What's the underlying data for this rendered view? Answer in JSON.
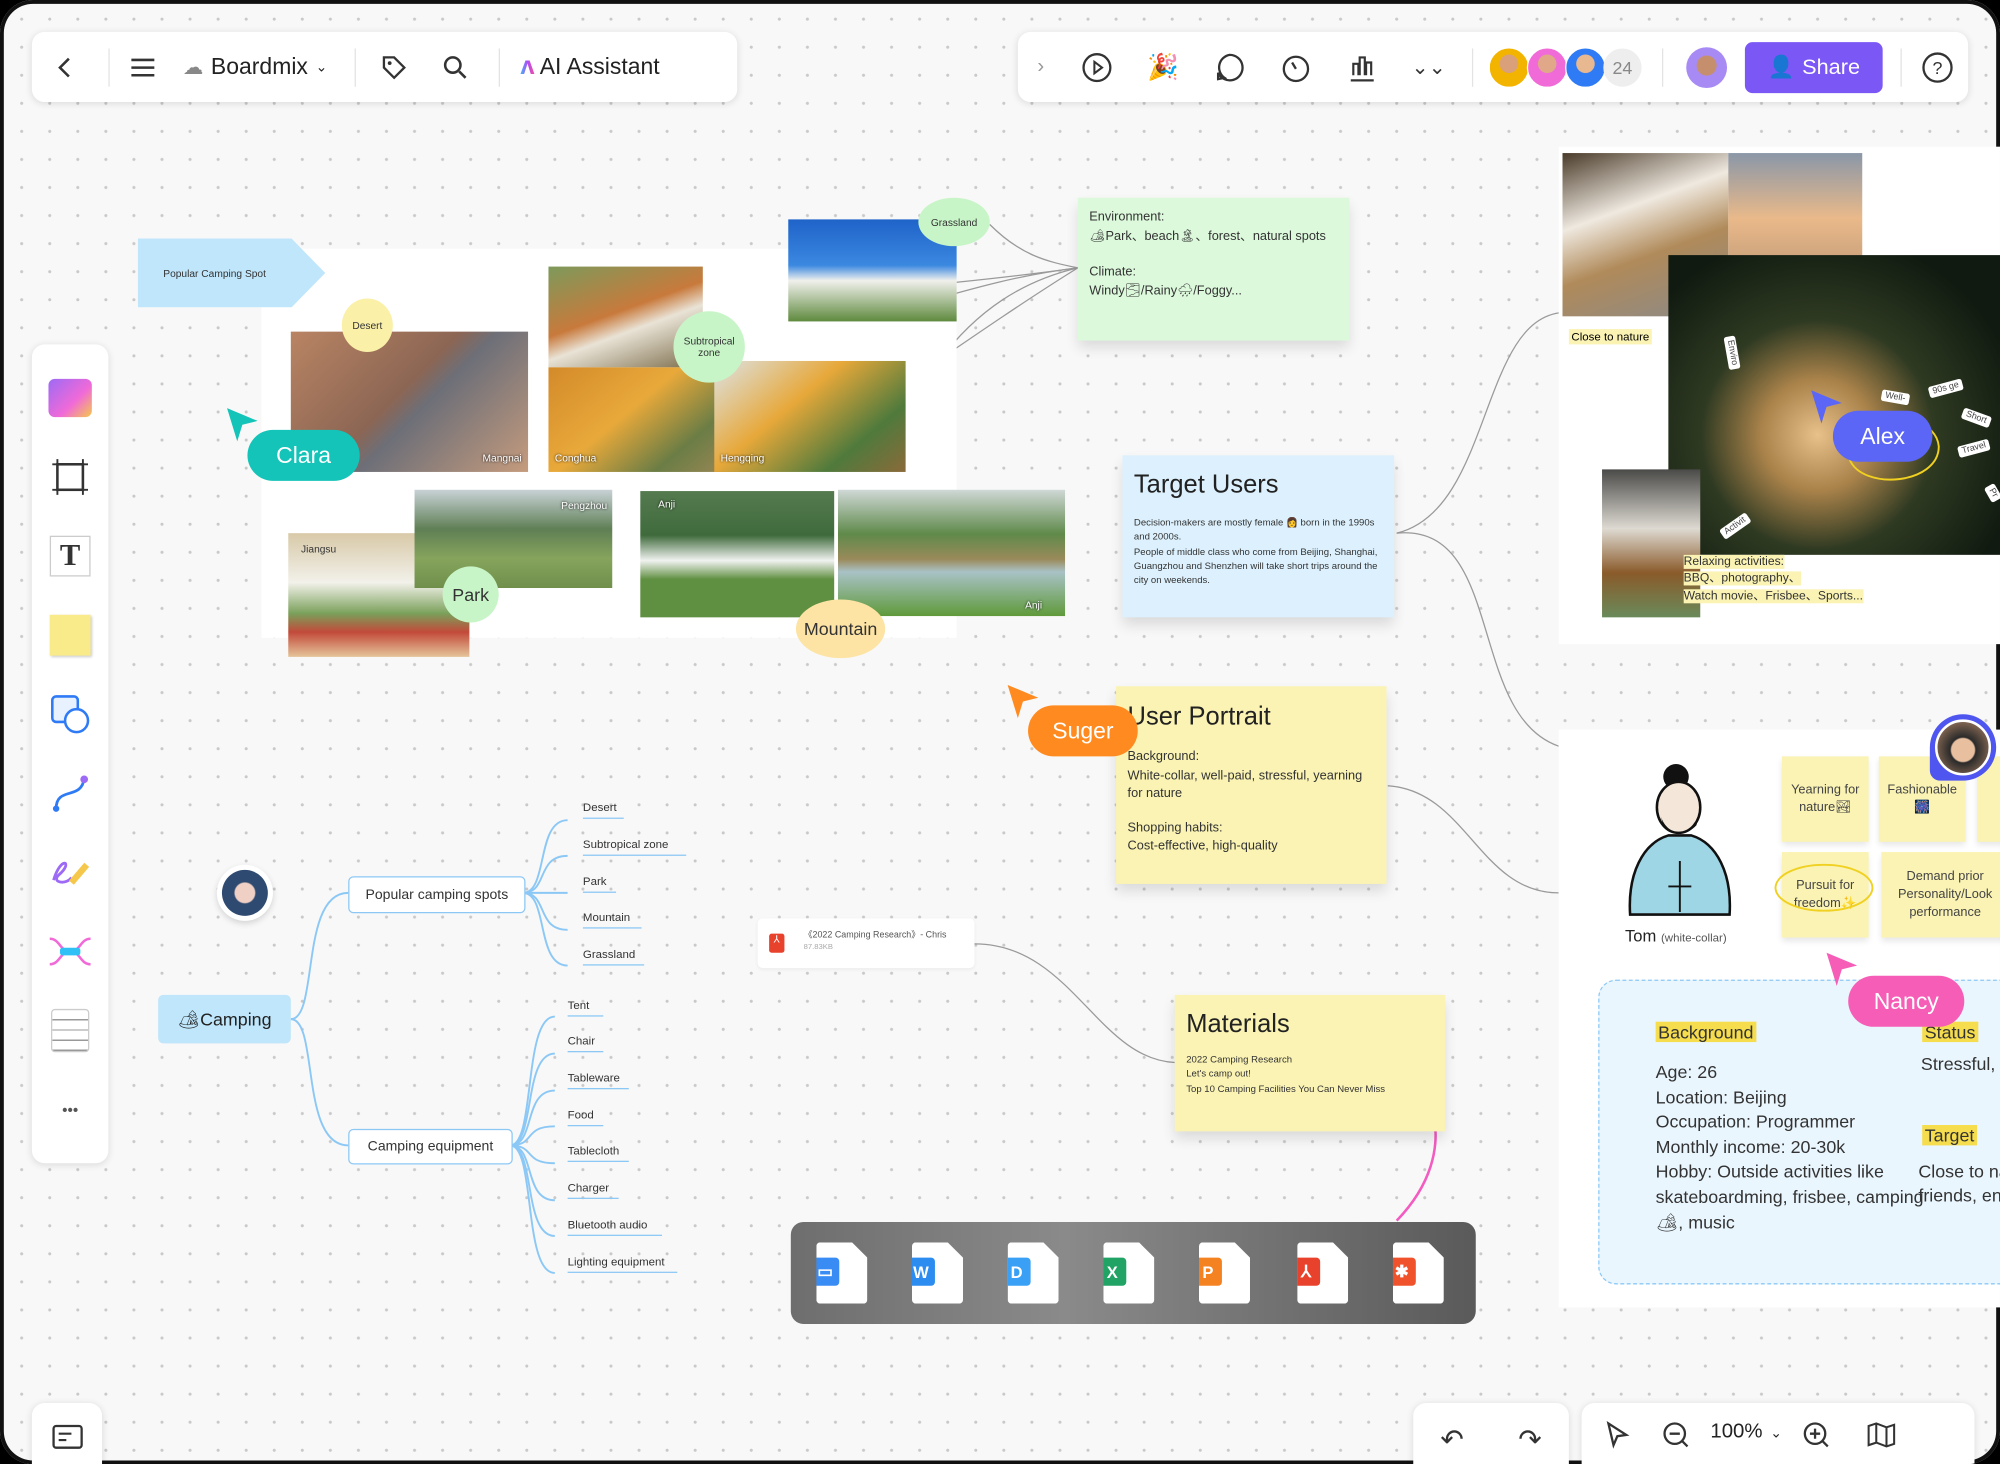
{
  "top_left_bar": {
    "app_name": "Boardmix",
    "ai_label": "AI Assistant",
    "icons": [
      "back-chevron",
      "menu",
      "cloud",
      "tag",
      "search"
    ]
  },
  "top_right_bar": {
    "collaborator_count": "24",
    "share_label": "Share",
    "icons": [
      "expand-chevron",
      "play",
      "celebrate",
      "comment",
      "timer",
      "chart",
      "more",
      "help"
    ]
  },
  "left_toolbar": {
    "tools": [
      "templates",
      "frame",
      "text",
      "sticky-note",
      "shape",
      "connector",
      "pen",
      "mindmap",
      "list",
      "more"
    ],
    "text_glyph": "T",
    "more_glyph": "•••"
  },
  "bottom_bar": {
    "zoom": "100%"
  },
  "board": {
    "spot_banner": "Popular Camping Spot",
    "bubbles": {
      "desert": "Desert",
      "subtropical": "Subtropical zone",
      "grassland": "Grassland",
      "park": "Park",
      "mountain": "Mountain"
    },
    "photo_labels": {
      "mangnai": "Mangnai",
      "conghua": "Conghua",
      "hengqing": "Hengqing",
      "jiangsu": "Jiangsu",
      "pengzhou": "Pengzhou",
      "anji1": "Anji",
      "anji2": "Anji"
    },
    "environment_note": {
      "env_title": "Environment:",
      "env_text": "🏕Park、beach🏝、forest、natural spots",
      "climate_title": "Climate:",
      "climate_text": "Windy🌫/Rainy🌧/Foggy..."
    },
    "target_users": {
      "title": "Target Users",
      "line1": "Decision-makers are mostly female 👩 born in the 1990s and 2000s.",
      "line2": "People of middle class who come from Beijing, Shanghai, Guangzhou and Shenzhen will take short trips around the city on weekends."
    },
    "photo_panel": {
      "close_to_nature": "Close to nature",
      "relax_title": "Relaxing activities:",
      "relax_1": "BBQ、photography、",
      "relax_2": "Watch movie、Frisbee、Sports...",
      "tags": [
        "Enviro",
        "Well-",
        "90s ge",
        "Short",
        "Travel",
        "Activit",
        "Pr"
      ]
    },
    "user_portrait": {
      "title": "User Portrait",
      "bg_title": "Background:",
      "bg_text": "White-collar, well-paid, stressful, yearning for nature",
      "shop_title": "Shopping habits:",
      "shop_text": "Cost-effective, high-quality"
    },
    "persona": {
      "name": "Tom",
      "role": "(white-collar)",
      "stickies": [
        "Yearning for nature🏞",
        "Fashionable 🎆",
        "Pursuit for freedom✨",
        "Demand prior Personality/Look performance"
      ]
    },
    "profile": {
      "background_label": "Background",
      "age": "Age:  26",
      "location": "Location:  Beijing",
      "occupation": "Occupation:  Programmer",
      "income": "Monthly income:  20-30k",
      "hobby": "Hobby:  Outside activities like skateboardming, frisbee, camping 🏕, music",
      "status_label": "Status",
      "status_text": "Stressful,",
      "target_label": "Target",
      "target_text1": "Close to na",
      "target_text2": "friends, en"
    },
    "mindmap": {
      "root": "🏕Camping",
      "branches": [
        {
          "label": "Popular camping spots",
          "children": [
            "Desert",
            "Subtropical zone",
            "Park",
            "Mountain",
            "Grassland"
          ]
        },
        {
          "label": "Camping equipment",
          "children": [
            "Tent",
            "Chair",
            "Tableware",
            "Food",
            "Tablecloth",
            "Charger",
            "Bluetooth audio",
            "Lighting equipment"
          ]
        }
      ]
    },
    "file_card": {
      "name": "《2022 Camping Research》- Chris",
      "size": "87.83KB"
    },
    "materials": {
      "title": "Materials",
      "items": [
        "2022 Camping Research",
        "Let's camp out!",
        "Top 10 Camping Facilities You Can Never Miss"
      ]
    },
    "dock": {
      "files": [
        {
          "type": "keynote",
          "glyph": "▭",
          "color": "#3a8cf5"
        },
        {
          "type": "word",
          "glyph": "W",
          "color": "#2d8cf0"
        },
        {
          "type": "mindmap",
          "glyph": "D",
          "color": "#3aa0f5"
        },
        {
          "type": "excel",
          "glyph": "X",
          "color": "#21a366"
        },
        {
          "type": "powerpoint",
          "glyph": "P",
          "color": "#f58220"
        },
        {
          "type": "pdf",
          "glyph": "⅄",
          "color": "#e8412c"
        },
        {
          "type": "xmind",
          "glyph": "✱",
          "color": "#f0532b"
        }
      ]
    }
  },
  "cursors": [
    {
      "name": "Clara",
      "color": "#14c4b8"
    },
    {
      "name": "Alex",
      "color": "#5b66f6"
    },
    {
      "name": "Suger",
      "color": "#ff8a1f"
    },
    {
      "name": "Nancy",
      "color": "#f65db7"
    }
  ]
}
